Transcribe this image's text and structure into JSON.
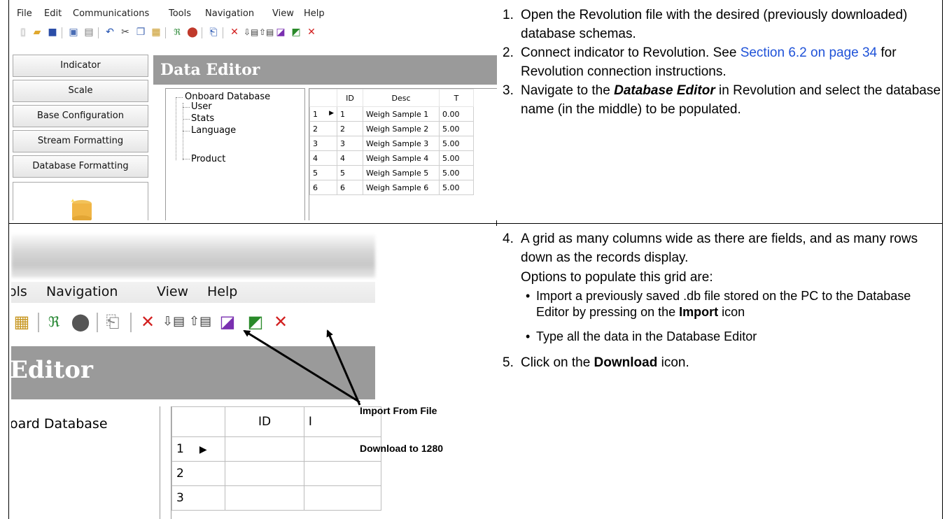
{
  "panel1": {
    "menu": [
      "File",
      "Edit",
      "Communications",
      "Tools",
      "Navigation",
      "View",
      "Help"
    ],
    "nav_buttons": [
      "Indicator",
      "Scale",
      "Base Configuration",
      "Stream Formatting",
      "Database Formatting"
    ],
    "header": "Data Editor",
    "tree": {
      "root": "Onboard Database",
      "children": [
        "User",
        "Stats",
        "Language",
        "Product"
      ]
    },
    "grid": {
      "headers": [
        "",
        "ID",
        "Desc",
        "T"
      ],
      "rows": [
        [
          "1",
          "1",
          "Weigh Sample 1",
          "0.00"
        ],
        [
          "2",
          "2",
          "Weigh Sample 2",
          "5.00"
        ],
        [
          "3",
          "3",
          "Weigh Sample 3",
          "5.00"
        ],
        [
          "4",
          "4",
          "Weigh Sample 4",
          "5.00"
        ],
        [
          "5",
          "5",
          "Weigh Sample 5",
          "5.00"
        ],
        [
          "6",
          "6",
          "Weigh Sample 6",
          "5.00"
        ]
      ]
    }
  },
  "panel2": {
    "menu": [
      "ols",
      "Navigation",
      "View",
      "Help"
    ],
    "header": "Editor",
    "tree_root": "oard Database",
    "grid": {
      "headers": [
        "",
        "ID",
        "I"
      ],
      "row_numbers": [
        "1",
        "2",
        "3"
      ]
    },
    "callouts": {
      "import": "Import From File",
      "download": "Download to 1280"
    }
  },
  "steps": {
    "s1": {
      "num": "1.",
      "text": "Open the Revolution file with the desired (previously downloaded) database schemas."
    },
    "s2": {
      "num": "2.",
      "text_a": "Connect indicator to Revolution. See ",
      "link": "Section 6.2 on page 34",
      "text_b": " for Revolution connection instructions."
    },
    "s3": {
      "num": "3.",
      "text_a": "Navigate to the ",
      "emph": "Database Editor",
      "text_b": " in Revolution and select the database name (in the middle) to be populated."
    },
    "s4": {
      "num": "4.",
      "text": "A grid as many columns wide as there are fields, and as many rows down as the records display.",
      "options_intro": "Options to populate this grid are:",
      "bullet1_a": "Import a previously saved .db file stored on the PC to the Database Editor by pressing on the ",
      "bullet1_bold": "Import",
      "bullet1_b": " icon",
      "bullet2": "Type all the data in the Database Editor",
      "bullet_char": "•"
    },
    "s5": {
      "num": "5.",
      "text_a": "Click on the ",
      "bold": "Download",
      "text_b": " icon."
    }
  },
  "colors": {
    "link": "#1f52d8",
    "header_bg": "#9a9a9a"
  }
}
